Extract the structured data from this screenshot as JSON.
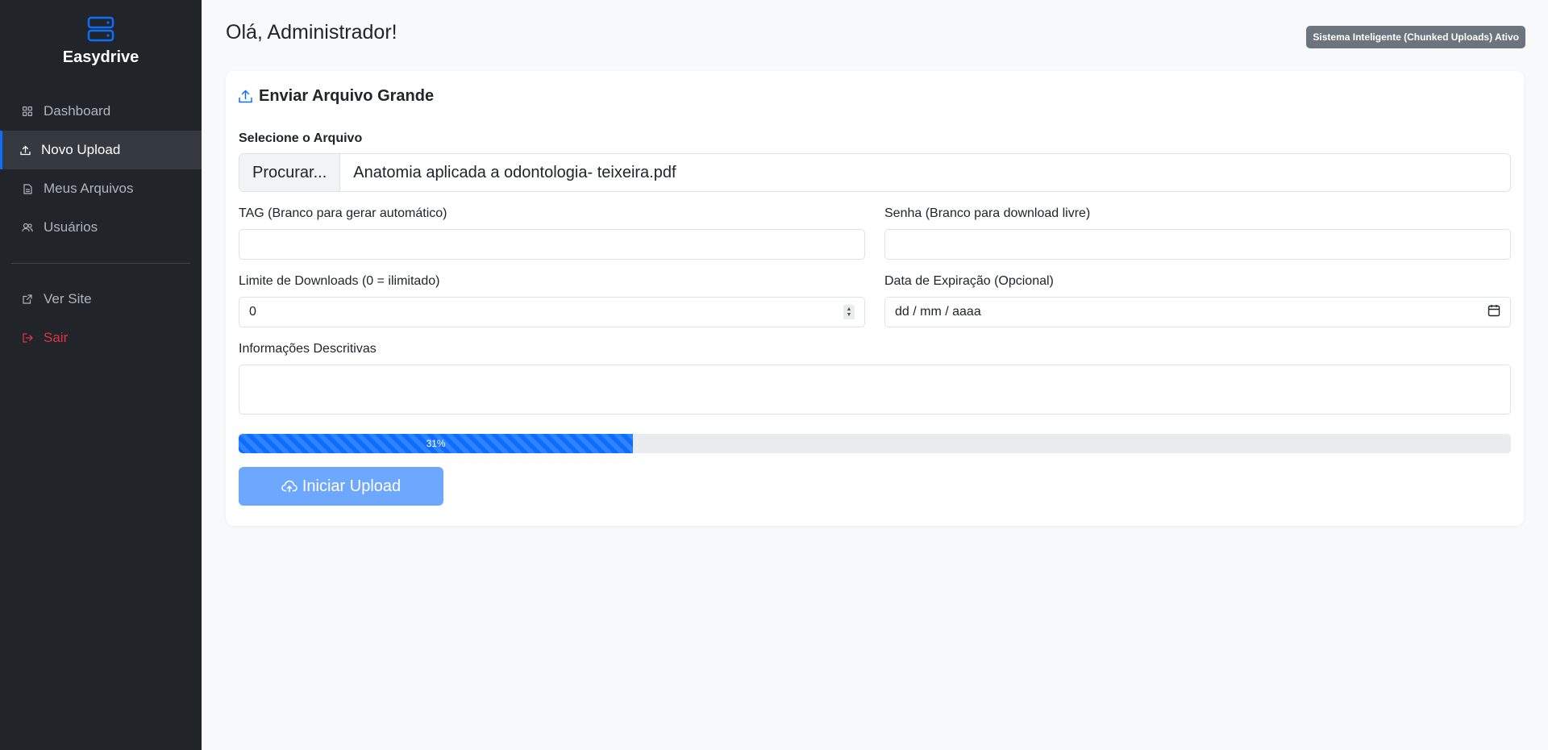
{
  "app": {
    "brand_name": "Easydrive",
    "brand_icon": "server-icon",
    "accent_color": "#0d6efd"
  },
  "sidebar": {
    "items": [
      {
        "label": "Dashboard",
        "icon": "grid-icon",
        "active": false
      },
      {
        "label": "Novo Upload",
        "icon": "upload-icon",
        "active": true
      },
      {
        "label": "Meus Arquivos",
        "icon": "file-icon",
        "active": false
      },
      {
        "label": "Usuários",
        "icon": "users-icon",
        "active": false
      }
    ],
    "bottom_items": [
      {
        "label": "Ver Site",
        "icon": "external-link-icon"
      },
      {
        "label": "Sair",
        "icon": "logout-icon",
        "color": "#dc3545"
      }
    ]
  },
  "header": {
    "greeting": "Olá, Administrador!",
    "status_badge": "Sistema Inteligente (Chunked Uploads) Ativo"
  },
  "card": {
    "title": "Enviar Arquivo Grande",
    "file_section_label": "Selecione o Arquivo",
    "browse_label": "Procurar...",
    "file_name": "Anatomia aplicada a odontologia- teixeira.pdf",
    "tag_label": "TAG (Branco para gerar automático)",
    "tag_value": "",
    "password_label": "Senha (Branco para download livre)",
    "password_value": "",
    "download_limit_label": "Limite de Downloads (0 = ilimitado)",
    "download_limit_value": "0",
    "expiration_label": "Data de Expiração (Opcional)",
    "expiration_placeholder": "dd / mm / aaaa",
    "description_label": "Informações Descritivas",
    "description_value": "",
    "progress_percent": 31,
    "progress_label": "31%",
    "upload_button_label": "Iniciar Upload"
  }
}
